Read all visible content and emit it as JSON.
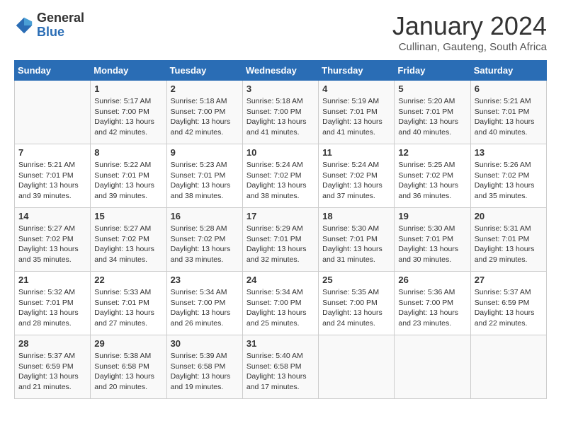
{
  "header": {
    "logo": {
      "general": "General",
      "blue": "Blue"
    },
    "title": "January 2024",
    "location": "Cullinan, Gauteng, South Africa"
  },
  "calendar": {
    "weekdays": [
      "Sunday",
      "Monday",
      "Tuesday",
      "Wednesday",
      "Thursday",
      "Friday",
      "Saturday"
    ],
    "weeks": [
      [
        {
          "date": "",
          "info": ""
        },
        {
          "date": "1",
          "info": "Sunrise: 5:17 AM\nSunset: 7:00 PM\nDaylight: 13 hours\nand 42 minutes."
        },
        {
          "date": "2",
          "info": "Sunrise: 5:18 AM\nSunset: 7:00 PM\nDaylight: 13 hours\nand 42 minutes."
        },
        {
          "date": "3",
          "info": "Sunrise: 5:18 AM\nSunset: 7:00 PM\nDaylight: 13 hours\nand 41 minutes."
        },
        {
          "date": "4",
          "info": "Sunrise: 5:19 AM\nSunset: 7:01 PM\nDaylight: 13 hours\nand 41 minutes."
        },
        {
          "date": "5",
          "info": "Sunrise: 5:20 AM\nSunset: 7:01 PM\nDaylight: 13 hours\nand 40 minutes."
        },
        {
          "date": "6",
          "info": "Sunrise: 5:21 AM\nSunset: 7:01 PM\nDaylight: 13 hours\nand 40 minutes."
        }
      ],
      [
        {
          "date": "7",
          "info": "Sunrise: 5:21 AM\nSunset: 7:01 PM\nDaylight: 13 hours\nand 39 minutes."
        },
        {
          "date": "8",
          "info": "Sunrise: 5:22 AM\nSunset: 7:01 PM\nDaylight: 13 hours\nand 39 minutes."
        },
        {
          "date": "9",
          "info": "Sunrise: 5:23 AM\nSunset: 7:01 PM\nDaylight: 13 hours\nand 38 minutes."
        },
        {
          "date": "10",
          "info": "Sunrise: 5:24 AM\nSunset: 7:02 PM\nDaylight: 13 hours\nand 38 minutes."
        },
        {
          "date": "11",
          "info": "Sunrise: 5:24 AM\nSunset: 7:02 PM\nDaylight: 13 hours\nand 37 minutes."
        },
        {
          "date": "12",
          "info": "Sunrise: 5:25 AM\nSunset: 7:02 PM\nDaylight: 13 hours\nand 36 minutes."
        },
        {
          "date": "13",
          "info": "Sunrise: 5:26 AM\nSunset: 7:02 PM\nDaylight: 13 hours\nand 35 minutes."
        }
      ],
      [
        {
          "date": "14",
          "info": "Sunrise: 5:27 AM\nSunset: 7:02 PM\nDaylight: 13 hours\nand 35 minutes."
        },
        {
          "date": "15",
          "info": "Sunrise: 5:27 AM\nSunset: 7:02 PM\nDaylight: 13 hours\nand 34 minutes."
        },
        {
          "date": "16",
          "info": "Sunrise: 5:28 AM\nSunset: 7:02 PM\nDaylight: 13 hours\nand 33 minutes."
        },
        {
          "date": "17",
          "info": "Sunrise: 5:29 AM\nSunset: 7:01 PM\nDaylight: 13 hours\nand 32 minutes."
        },
        {
          "date": "18",
          "info": "Sunrise: 5:30 AM\nSunset: 7:01 PM\nDaylight: 13 hours\nand 31 minutes."
        },
        {
          "date": "19",
          "info": "Sunrise: 5:30 AM\nSunset: 7:01 PM\nDaylight: 13 hours\nand 30 minutes."
        },
        {
          "date": "20",
          "info": "Sunrise: 5:31 AM\nSunset: 7:01 PM\nDaylight: 13 hours\nand 29 minutes."
        }
      ],
      [
        {
          "date": "21",
          "info": "Sunrise: 5:32 AM\nSunset: 7:01 PM\nDaylight: 13 hours\nand 28 minutes."
        },
        {
          "date": "22",
          "info": "Sunrise: 5:33 AM\nSunset: 7:01 PM\nDaylight: 13 hours\nand 27 minutes."
        },
        {
          "date": "23",
          "info": "Sunrise: 5:34 AM\nSunset: 7:00 PM\nDaylight: 13 hours\nand 26 minutes."
        },
        {
          "date": "24",
          "info": "Sunrise: 5:34 AM\nSunset: 7:00 PM\nDaylight: 13 hours\nand 25 minutes."
        },
        {
          "date": "25",
          "info": "Sunrise: 5:35 AM\nSunset: 7:00 PM\nDaylight: 13 hours\nand 24 minutes."
        },
        {
          "date": "26",
          "info": "Sunrise: 5:36 AM\nSunset: 7:00 PM\nDaylight: 13 hours\nand 23 minutes."
        },
        {
          "date": "27",
          "info": "Sunrise: 5:37 AM\nSunset: 6:59 PM\nDaylight: 13 hours\nand 22 minutes."
        }
      ],
      [
        {
          "date": "28",
          "info": "Sunrise: 5:37 AM\nSunset: 6:59 PM\nDaylight: 13 hours\nand 21 minutes."
        },
        {
          "date": "29",
          "info": "Sunrise: 5:38 AM\nSunset: 6:58 PM\nDaylight: 13 hours\nand 20 minutes."
        },
        {
          "date": "30",
          "info": "Sunrise: 5:39 AM\nSunset: 6:58 PM\nDaylight: 13 hours\nand 19 minutes."
        },
        {
          "date": "31",
          "info": "Sunrise: 5:40 AM\nSunset: 6:58 PM\nDaylight: 13 hours\nand 17 minutes."
        },
        {
          "date": "",
          "info": ""
        },
        {
          "date": "",
          "info": ""
        },
        {
          "date": "",
          "info": ""
        }
      ]
    ]
  }
}
